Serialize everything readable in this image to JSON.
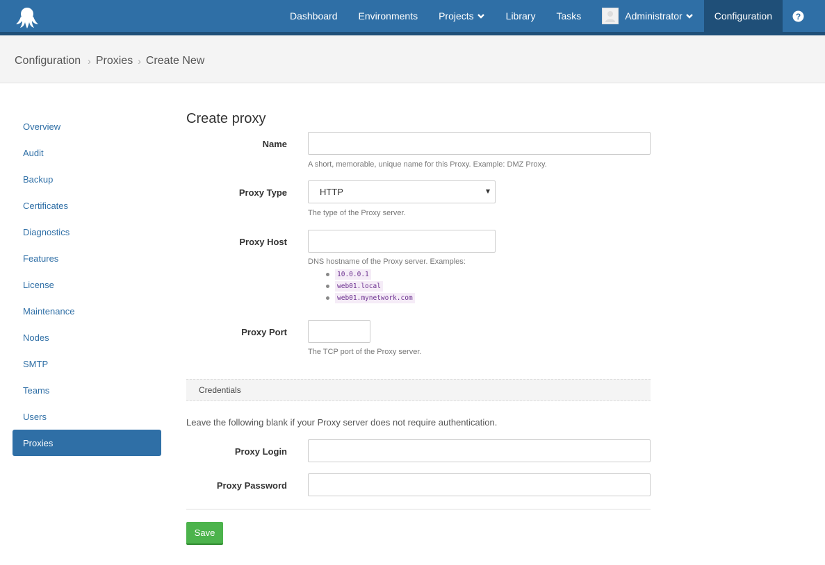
{
  "nav": {
    "items": [
      "Dashboard",
      "Environments",
      "Projects",
      "Library",
      "Tasks"
    ],
    "user": "Administrator",
    "active": "Configuration"
  },
  "breadcrumb": [
    "Configuration",
    "Proxies",
    "Create New"
  ],
  "sidebar": {
    "items": [
      "Overview",
      "Audit",
      "Backup",
      "Certificates",
      "Diagnostics",
      "Features",
      "License",
      "Maintenance",
      "Nodes",
      "SMTP",
      "Teams",
      "Users",
      "Proxies"
    ],
    "active": "Proxies"
  },
  "form": {
    "title": "Create proxy",
    "name": {
      "label": "Name",
      "value": "",
      "help": "A short, memorable, unique name for this Proxy. Example: DMZ Proxy."
    },
    "proxy_type": {
      "label": "Proxy Type",
      "value": "HTTP",
      "help": "The type of the Proxy server."
    },
    "proxy_host": {
      "label": "Proxy Host",
      "value": "",
      "help": "DNS hostname of the Proxy server. Examples:",
      "examples": [
        "10.0.0.1",
        "web01.local",
        "web01.mynetwork.com"
      ]
    },
    "proxy_port": {
      "label": "Proxy Port",
      "value": "",
      "help": "The TCP port of the Proxy server."
    },
    "credentials_header": "Credentials",
    "credentials_note": "Leave the following blank if your Proxy server does not require authentication.",
    "proxy_login": {
      "label": "Proxy Login",
      "value": ""
    },
    "proxy_password": {
      "label": "Proxy Password",
      "value": ""
    },
    "save_label": "Save"
  },
  "colors": {
    "brand": "#2f6fa6",
    "brand_dark": "#1f4f78",
    "save": "#4cb34c"
  }
}
